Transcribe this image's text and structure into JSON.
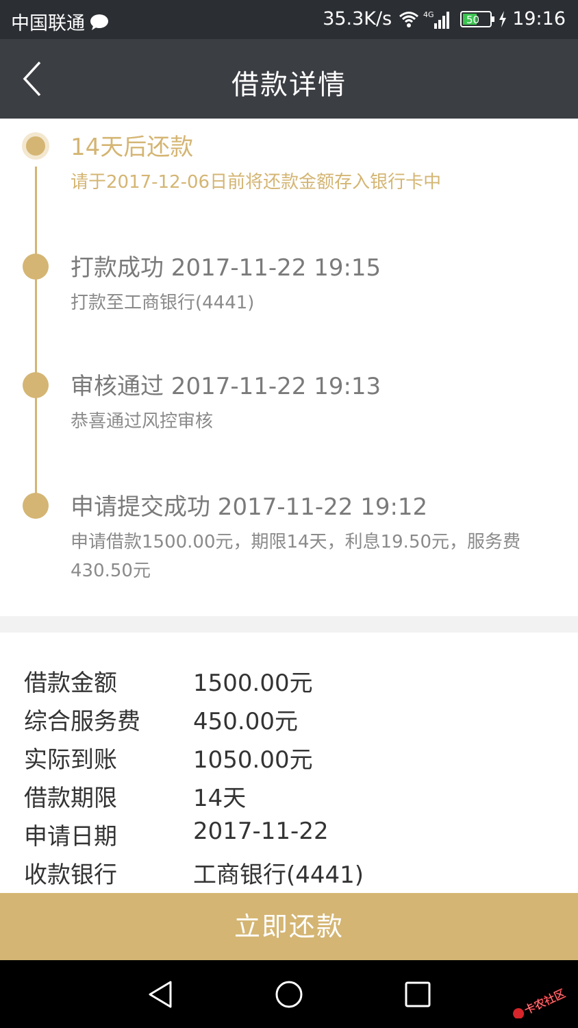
{
  "status_bar": {
    "carrier": "中国联通",
    "net_speed": "35.3K/s",
    "network": "4G",
    "battery": "50",
    "time": "19:16"
  },
  "nav": {
    "title": "借款详情"
  },
  "timeline": [
    {
      "title": "14天后还款",
      "desc": "请于2017-12-06日前将还款金额存入银行卡中",
      "highlight": true
    },
    {
      "title": "打款成功 2017-11-22 19:15",
      "desc": "打款至工商银行(4441)",
      "highlight": false
    },
    {
      "title": "审核通过 2017-11-22 19:13",
      "desc": "恭喜通过风控审核",
      "highlight": false
    },
    {
      "title": "申请提交成功 2017-11-22 19:12",
      "desc": "申请借款1500.00元，期限14天，利息19.50元，服务费430.50元",
      "highlight": false
    }
  ],
  "details": [
    {
      "label": "借款金额",
      "value": "1500.00元"
    },
    {
      "label": "综合服务费",
      "value": "450.00元"
    },
    {
      "label": "实际到账",
      "value": "1050.00元"
    },
    {
      "label": "借款期限",
      "value": "14天"
    },
    {
      "label": "申请日期",
      "value": "2017-11-22"
    },
    {
      "label": "收款银行",
      "value": "工商银行(4441)"
    }
  ],
  "actions": {
    "repay_label": "立即还款"
  },
  "watermark": "卡农社区",
  "colors": {
    "gold": "#d4b573",
    "status_bar": "#2b2e33",
    "nav_bar": "#3b3e43"
  },
  "icons": {
    "back": "chevron-left-icon",
    "wifi": "wifi-icon",
    "signal": "signal-icon",
    "battery": "battery-icon"
  }
}
